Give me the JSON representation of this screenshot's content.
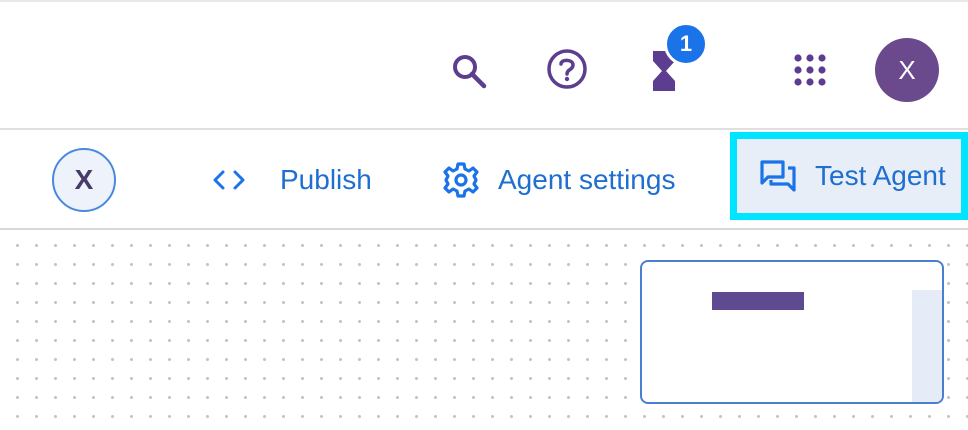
{
  "colors": {
    "brand_purple": "#5c3d8f",
    "primary_blue": "#1a73e8",
    "highlight": "#00e5ff"
  },
  "topbar": {
    "icons": [
      "search-icon",
      "help-icon",
      "hourglass-icon",
      "apps-grid-icon"
    ],
    "notification_count": "1",
    "avatar_initial": "X"
  },
  "toolbar": {
    "agent_avatar_initial": "X",
    "publish_label": "Publish",
    "settings_label": "Agent settings",
    "test_agent_label": "Test Agent"
  }
}
